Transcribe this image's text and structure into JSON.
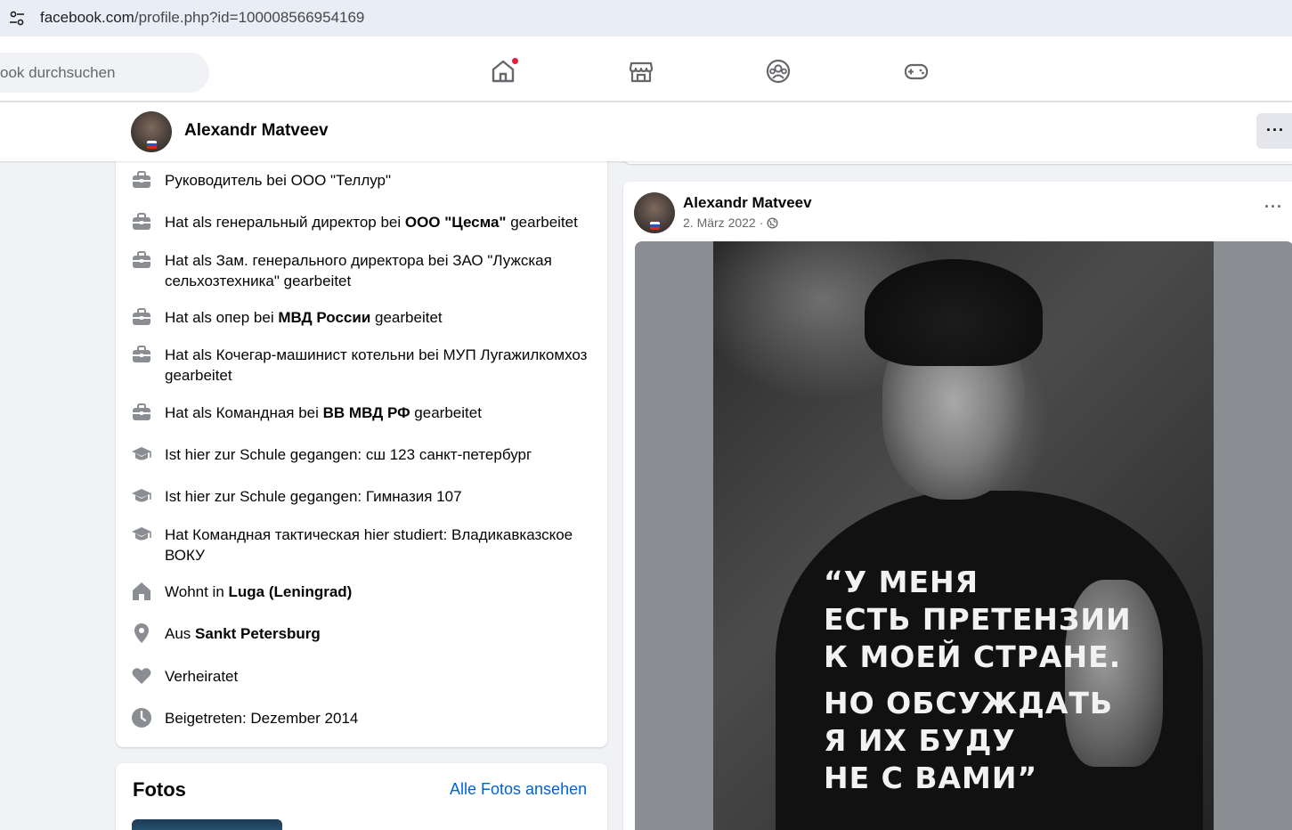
{
  "browser": {
    "url_host": "facebook.com",
    "url_path": "/profile.php?id=100008566954169"
  },
  "header": {
    "search_placeholder": "ook durchsuchen",
    "nav_icons": [
      "home-icon",
      "marketplace-icon",
      "groups-icon",
      "gaming-icon"
    ],
    "notification_color": "#e41e3f"
  },
  "profile": {
    "name": "Alexandr Matveev",
    "more_label": "···"
  },
  "intro": {
    "items": [
      {
        "icon": "work-icon",
        "parts": [
          "Руководитель bei ООО \"Теллур\""
        ],
        "bold": []
      },
      {
        "icon": "work-icon",
        "pre": "Hat als генеральный директор bei ",
        "bold": "ООО \"Цесма\"",
        "post": " gearbeitet"
      },
      {
        "icon": "work-icon",
        "pre": "Hat als Зам. генерального директора bei ЗАО \"Лужская сельхозтехника\" gearbeitet",
        "bold": "",
        "post": ""
      },
      {
        "icon": "work-icon",
        "pre": "Hat als опер bei ",
        "bold": "МВД России",
        "post": " gearbeitet"
      },
      {
        "icon": "work-icon",
        "pre": "Hat als Кочегар-машинист котельни bei МУП Лугажилкомхоз gearbeitet",
        "bold": "",
        "post": ""
      },
      {
        "icon": "work-icon",
        "pre": "Hat als Командная bei ",
        "bold": "ВВ МВД РФ",
        "post": " gearbeitet"
      },
      {
        "icon": "education-icon",
        "pre": "Ist hier zur Schule gegangen: сш 123 санкт-петербург",
        "bold": "",
        "post": ""
      },
      {
        "icon": "education-icon",
        "pre": "Ist hier zur Schule gegangen: Гимназия 107",
        "bold": "",
        "post": ""
      },
      {
        "icon": "education-icon",
        "pre": "Hat Командная тактическая hier studiert: Владикавказское ВОКУ",
        "bold": "",
        "post": ""
      },
      {
        "icon": "home-icon",
        "pre": "Wohnt in ",
        "bold": "Luga (Leningrad)",
        "post": ""
      },
      {
        "icon": "location-icon",
        "pre": "Aus ",
        "bold": "Sankt Petersburg",
        "post": ""
      },
      {
        "icon": "heart-icon",
        "pre": "Verheiratet",
        "bold": "",
        "post": ""
      },
      {
        "icon": "clock-icon",
        "pre": "Beigetreten: Dezember 2014",
        "bold": "",
        "post": ""
      }
    ]
  },
  "fotos": {
    "title": "Fotos",
    "link": "Alle Fotos ansehen"
  },
  "post": {
    "author": "Alexandr Matveev",
    "date": "2. März 2022",
    "separator": " · ",
    "privacy_icon": "globe-icon",
    "more_label": "···",
    "image_text_lines": [
      "“У МЕНЯ",
      "ЕСТЬ ПРЕТЕНЗИИ",
      "К МОЕЙ СТРАНЕ.",
      "НО ОБСУЖДАТЬ",
      "Я ИХ БУДУ",
      "НЕ С ВАМИ”"
    ]
  }
}
